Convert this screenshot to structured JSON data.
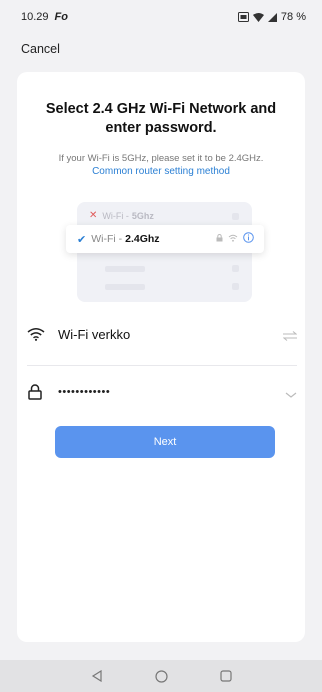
{
  "status_bar": {
    "time": "10.29",
    "app_badge": "Fo",
    "battery": "78 %"
  },
  "header": {
    "cancel_label": "Cancel"
  },
  "main": {
    "title": "Select 2.4 GHz Wi-Fi Network and enter password.",
    "hint": "If your Wi-Fi is 5GHz, please set it to be 2.4GHz.",
    "hint_link": "Common router setting method",
    "illustration": {
      "row_5g_prefix": "Wi-Fi -",
      "row_5g_band": "5Ghz",
      "row_24_prefix": "Wi-Fi -",
      "row_24_band": "2.4Ghz"
    },
    "wifi_field": {
      "value": "Wi-Fi verkko",
      "icon": "wifi-icon",
      "right_icon": "switch-arrows-icon"
    },
    "password_field": {
      "value": "••••••••••••",
      "icon": "lock-icon",
      "right_icon": "chevron-down-icon"
    },
    "next_label": "Next"
  },
  "colors": {
    "accent": "#5a94ee",
    "link": "#2a7fd4",
    "error": "#e05a5a"
  }
}
